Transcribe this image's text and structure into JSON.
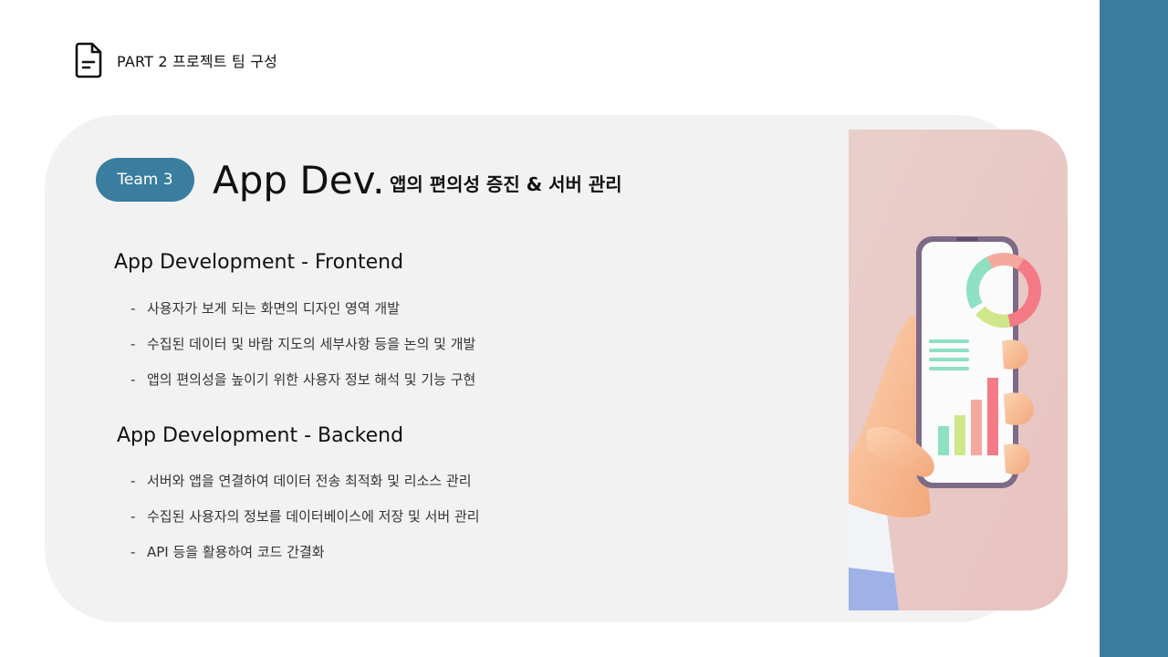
{
  "header": {
    "label": "PART 2 프로젝트 팀 구성",
    "icon": "document-icon"
  },
  "badge": {
    "label": "Team 3"
  },
  "title": "App Dev.",
  "subtitle": "앱의 편의성 증진 & 서버 관리",
  "sections": [
    {
      "title": "App Development - Frontend",
      "bullets": [
        "사용자가 보게 되는 화면의 디자인 영역 개발",
        "수집된 데이터 및 바람 지도의 세부사항 등을 논의 및 개발",
        "앱의 편의성을 높이기 위한 사용자 정보 해석 및 기능 구현"
      ]
    },
    {
      "title": "App Development - Backend",
      "bullets": [
        "서버와 앱을 연결하여 데이터 전송 최적화 및 리소스 관리",
        "수집된 사용자의 정보를 데이터베이스에 저장 및 서버 관리",
        "API 등을 활용하여 코드 간결화"
      ]
    }
  ],
  "colors": {
    "accent": "#3a7d9e",
    "card_background": "#f2f2f2",
    "illustration_background": "#ebc9c6"
  }
}
